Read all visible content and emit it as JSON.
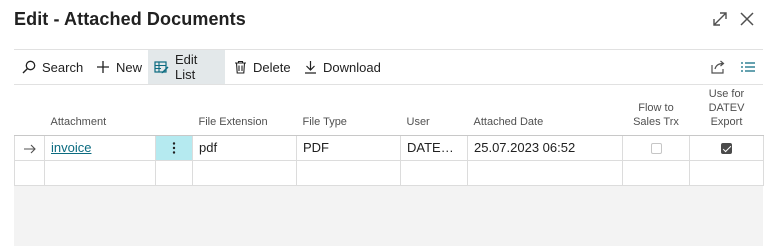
{
  "page": {
    "title": "Edit - Attached Documents"
  },
  "actions": {
    "search": "Search",
    "new": "New",
    "edit_list": "Edit List",
    "delete": "Delete",
    "download": "Download"
  },
  "columns": {
    "attachment": "Attachment",
    "file_extension": "File Extension",
    "file_type": "File Type",
    "user": "User",
    "attached_date": "Attached Date",
    "flow_to_sales_trx_line1": "Flow to",
    "flow_to_sales_trx_line2": "Sales Trx",
    "use_for_datev_line1": "Use for",
    "use_for_datev_line2": "DATEV",
    "use_for_datev_line3": "Export"
  },
  "rows": [
    {
      "attachment": "invoice",
      "file_extension": "pdf",
      "file_type": "PDF",
      "user": "DATEV\\F...",
      "attached_date": "25.07.2023 06:52",
      "flow_to_sales_trx": false,
      "use_for_datev_export": true
    }
  ],
  "icons": {
    "expand": "expand-icon",
    "close": "close-icon",
    "search": "search-icon",
    "new": "plus-icon",
    "edit_list": "edit-list-icon",
    "delete": "trash-icon",
    "download": "download-icon",
    "share": "share-icon",
    "list_view": "list-view-icon",
    "row_selected": "arrow-right-icon",
    "row_actions": "ellipsis-vertical-icon"
  },
  "colors": {
    "accent": "#0b6b80",
    "selected_cell": "#b5eaf0",
    "active_action": "#e3e8ea"
  }
}
